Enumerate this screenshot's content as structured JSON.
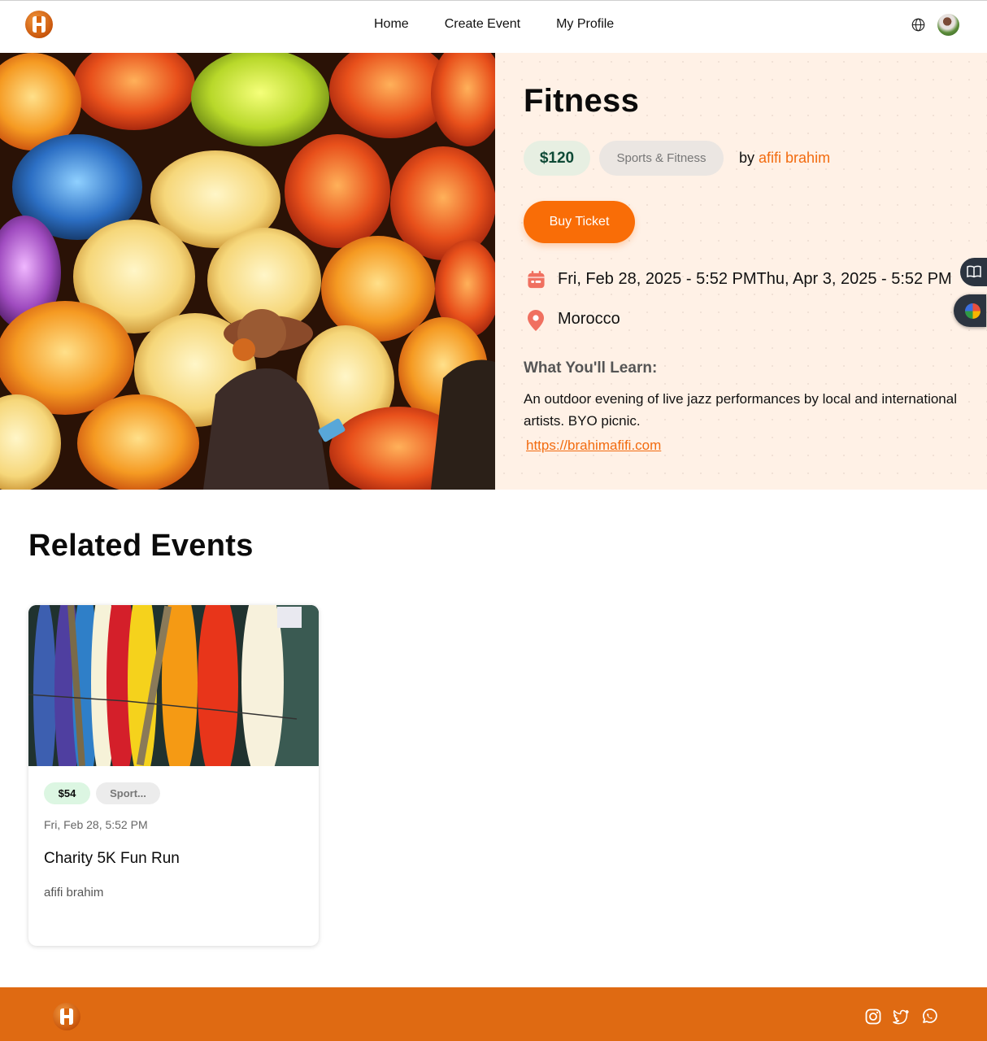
{
  "header": {
    "logo": "brand-logo",
    "nav": [
      {
        "label": "Home"
      },
      {
        "label": "Create Event"
      },
      {
        "label": "My Profile"
      }
    ],
    "language_icon": "globe-icon",
    "avatar": "user-avatar"
  },
  "event": {
    "title": "Fitness",
    "price": "$120",
    "category": "Sports & Fitness",
    "by_prefix": "by",
    "author": "afifi brahim",
    "buy_label": "Buy Ticket",
    "date_range": "Fri, Feb 28, 2025 - 5:52 PMThu, Apr 3, 2025 - 5:52 PM",
    "location": "Morocco",
    "learn_heading": "What You'll Learn:",
    "description": "An outdoor evening of live jazz performances by local and international artists. BYO picnic.",
    "link": "https://brahimafifi.com",
    "image": "lanterns-photo"
  },
  "related": {
    "heading": "Related Events",
    "cards": [
      {
        "price": "$54",
        "category": "Sport...",
        "date": "Fri, Feb 28, 5:52 PM",
        "title": "Charity 5K Fun Run",
        "author": "afifi brahim",
        "image": "surfboards-photo"
      }
    ]
  },
  "side_tabs": [
    "book-icon",
    "color-ball-icon"
  ],
  "footer": {
    "social": [
      "instagram-icon",
      "twitter-icon",
      "whatsapp-icon"
    ]
  },
  "colors": {
    "accent": "#f96d07",
    "footer": "#df6a12",
    "panel": "#fff1e6"
  }
}
